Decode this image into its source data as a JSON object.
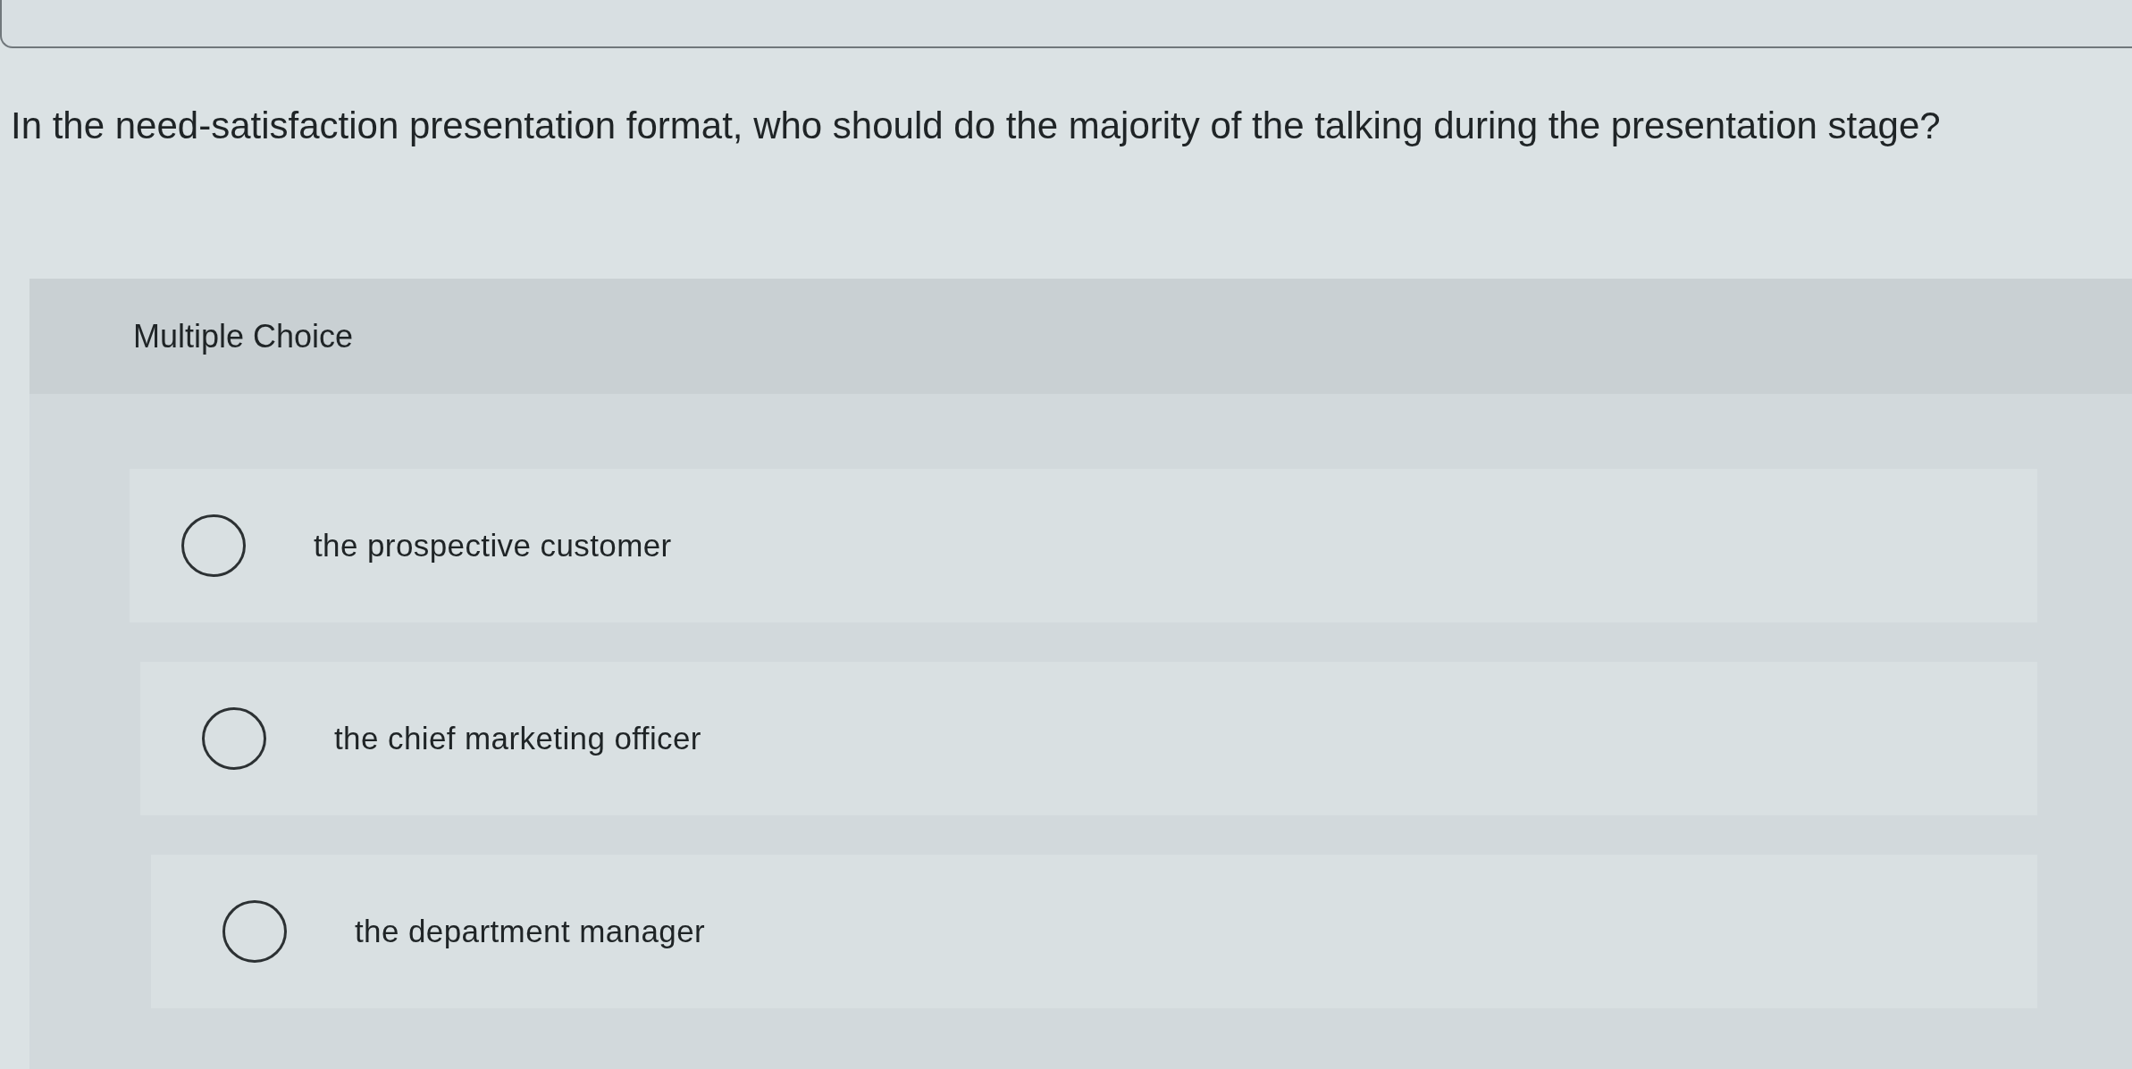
{
  "question": "In the need-satisfaction presentation format, who should do the majority of the talking during the presentation stage?",
  "answer_panel": {
    "header": "Multiple Choice",
    "options": [
      {
        "label": "the prospective customer",
        "selected": false
      },
      {
        "label": "the chief marketing officer",
        "selected": false
      },
      {
        "label": "the department manager",
        "selected": false
      }
    ]
  }
}
